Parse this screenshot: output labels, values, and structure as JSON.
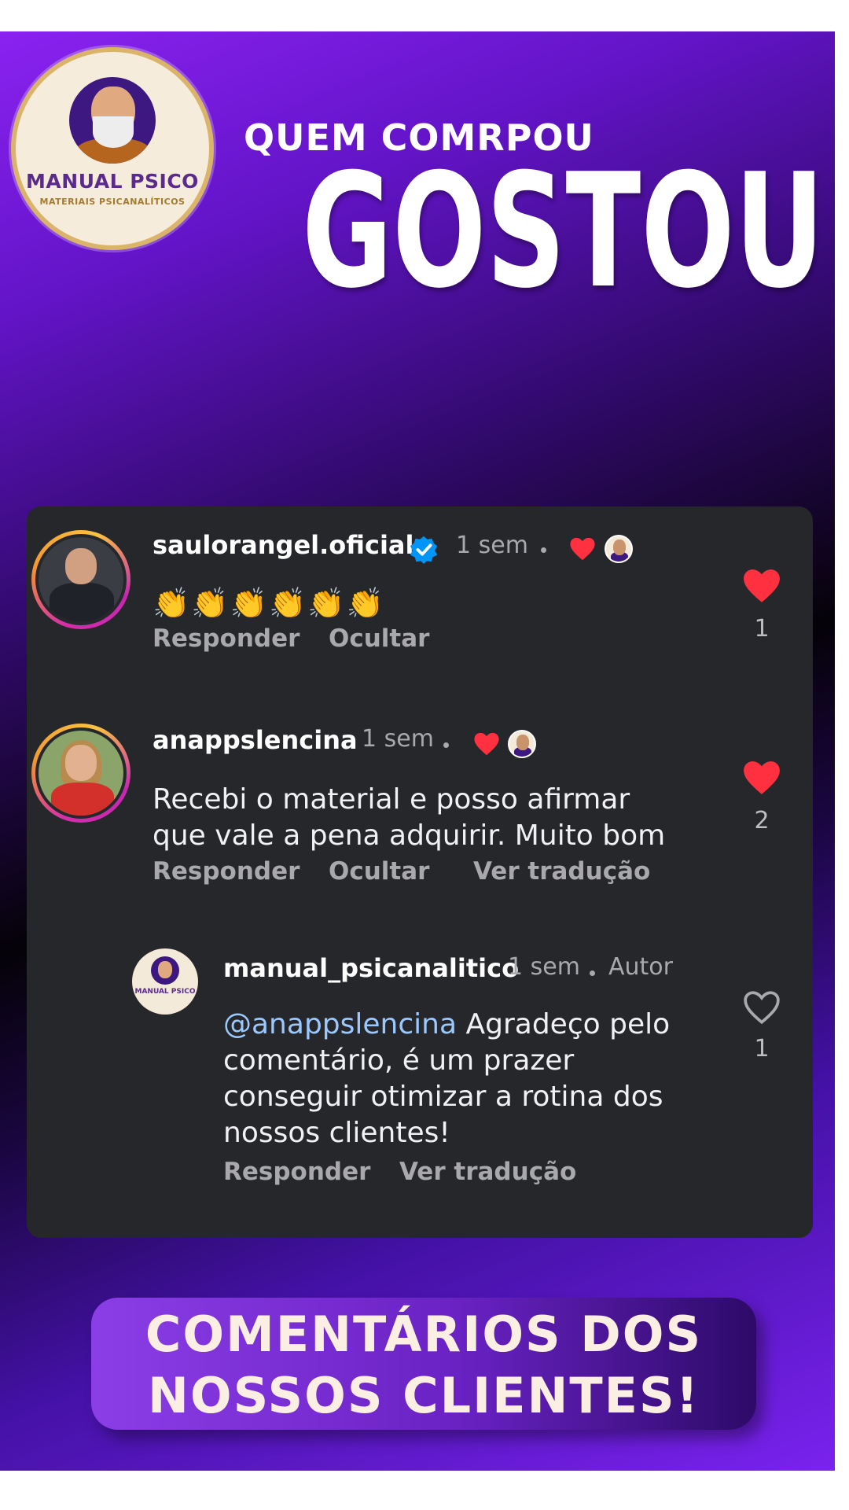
{
  "header": {
    "logo_title": "MANUAL PSICO",
    "logo_subtitle": "MATERIAIS PSICANALÍTICOS",
    "headline_small": "QUEM COMRPOU",
    "headline_big": "GOSTOU"
  },
  "comments": [
    {
      "username": "saulorangel.oficial",
      "verified": true,
      "time": "1 sem",
      "text": "👏👏👏👏👏👏",
      "actions": [
        "Responder",
        "Ocultar"
      ],
      "liked": true,
      "likes": "1"
    },
    {
      "username": "anappslencina",
      "verified": false,
      "time": "1 sem",
      "text_line1": "Recebi o material e posso afirmar",
      "text_line2": "que vale a pena adquirir. Muito bom",
      "actions": [
        "Responder",
        "Ocultar",
        "Ver tradução"
      ],
      "liked": true,
      "likes": "2"
    }
  ],
  "reply": {
    "username": "manual_psicanalitico",
    "time": "1 sem",
    "author_label": "Autor",
    "mention": "@anappslencina",
    "text_line1": " Agradeço pelo",
    "text_line2": "comentário, é um prazer",
    "text_line3": "conseguir otimizar a rotina dos",
    "text_line4": "nossos clientes!",
    "actions": [
      "Responder",
      "Ver tradução"
    ],
    "liked": false,
    "likes": "1",
    "avatar_text": "MANUAL PSICO"
  },
  "banner": {
    "line1": "COMENTÁRIOS DOS",
    "line2": "NOSSOS CLIENTES!"
  },
  "colors": {
    "purple_accent": "#8a22f0",
    "card_bg": "#26272b",
    "heart_red": "#ff3040",
    "verified_blue": "#0095f6",
    "mention_blue": "#9ac8ff"
  },
  "icons": {
    "verified": "verified-badge-icon",
    "like_filled": "heart-filled-icon",
    "like_outline": "heart-outline-icon"
  }
}
